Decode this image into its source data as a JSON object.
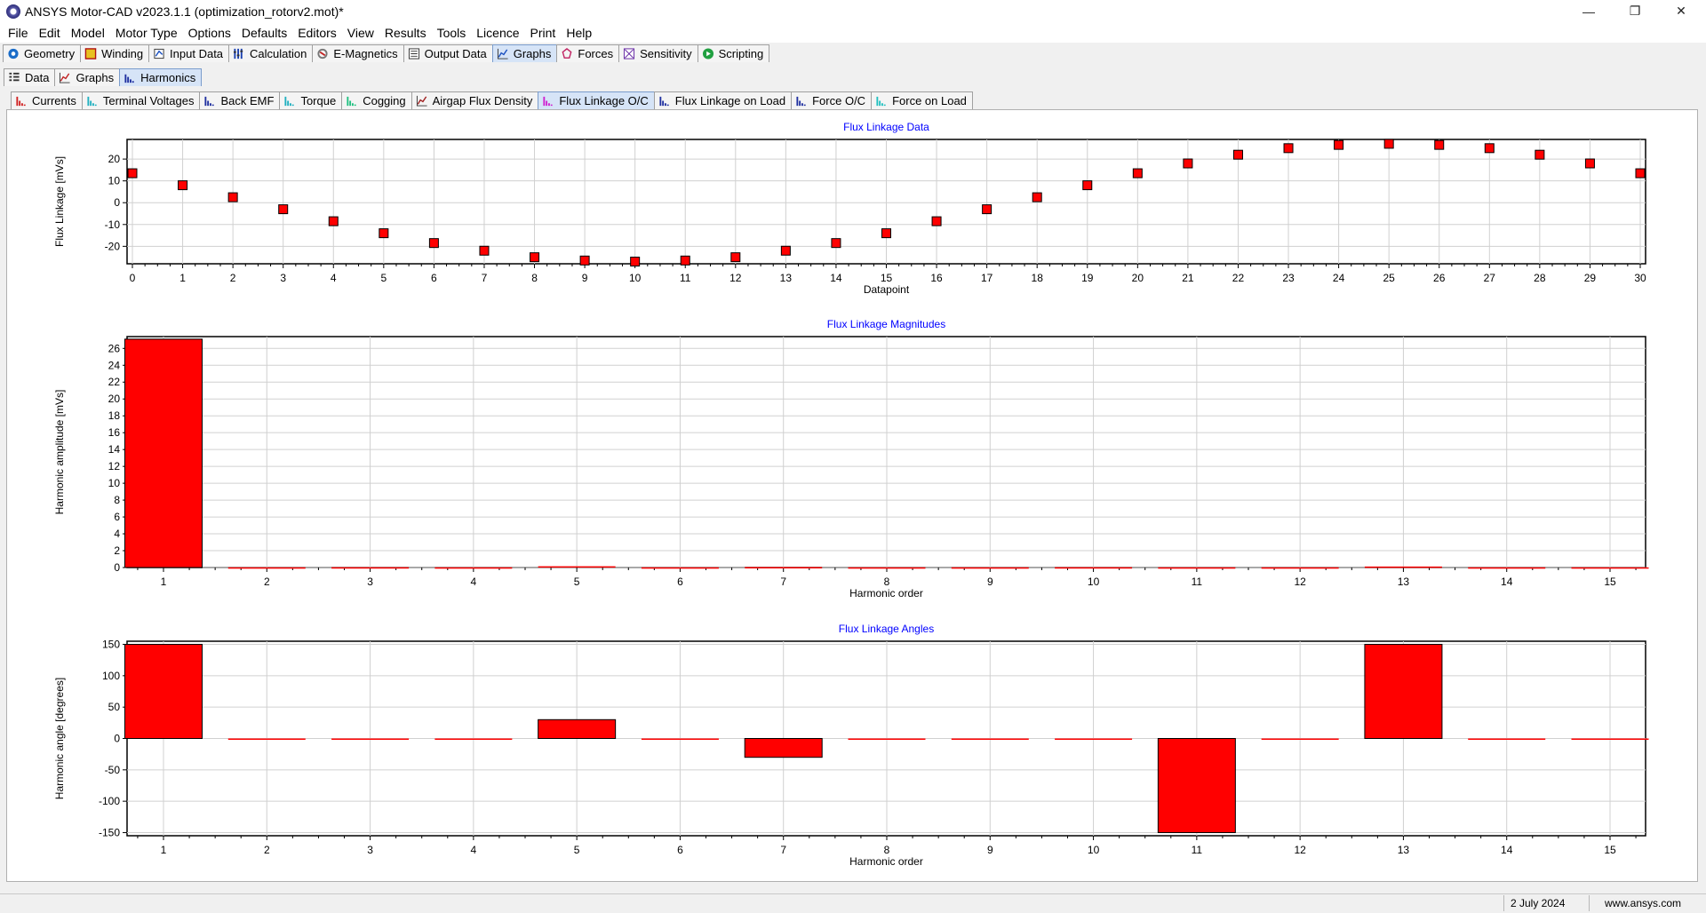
{
  "window": {
    "title": "ANSYS Motor-CAD v2023.1.1 (optimization_rotorv2.mot)*",
    "controls": [
      "minimize-icon",
      "restore-icon",
      "close-icon"
    ]
  },
  "menu": [
    "File",
    "Edit",
    "Model",
    "Motor Type",
    "Options",
    "Defaults",
    "Editors",
    "View",
    "Results",
    "Tools",
    "Licence",
    "Print",
    "Help"
  ],
  "main_tabs": [
    {
      "label": "Geometry",
      "icon": "geometry-icon",
      "active": false
    },
    {
      "label": "Winding",
      "icon": "winding-icon",
      "active": false
    },
    {
      "label": "Input Data",
      "icon": "input-data-icon",
      "active": false
    },
    {
      "label": "Calculation",
      "icon": "calculation-icon",
      "active": false
    },
    {
      "label": "E-Magnetics",
      "icon": "e-magnetics-icon",
      "active": false
    },
    {
      "label": "Output Data",
      "icon": "output-data-icon",
      "active": false
    },
    {
      "label": "Graphs",
      "icon": "graphs-icon",
      "active": true
    },
    {
      "label": "Forces",
      "icon": "forces-icon",
      "active": false
    },
    {
      "label": "Sensitivity",
      "icon": "sensitivity-icon",
      "active": false
    },
    {
      "label": "Scripting",
      "icon": "scripting-icon",
      "active": false
    }
  ],
  "sub_tabs": [
    {
      "label": "Data",
      "icon": "data-grid-icon",
      "active": false
    },
    {
      "label": "Graphs",
      "icon": "line-graph-icon",
      "active": false
    },
    {
      "label": "Harmonics",
      "icon": "harmonics-icon",
      "active": true
    }
  ],
  "harmonic_tabs": [
    {
      "label": "Currents",
      "color": "#d02020",
      "active": false
    },
    {
      "label": "Terminal Voltages",
      "color": "#20b0c0",
      "active": false
    },
    {
      "label": "Back EMF",
      "color": "#2030a0",
      "active": false
    },
    {
      "label": "Torque",
      "color": "#20b0c0",
      "active": false
    },
    {
      "label": "Cogging",
      "color": "#20c080",
      "active": false
    },
    {
      "label": "Airgap Flux Density",
      "color": "#a02020",
      "active": false
    },
    {
      "label": "Flux Linkage O/C",
      "color": "#d020d0",
      "active": true
    },
    {
      "label": "Flux Linkage on Load",
      "color": "#2030a0",
      "active": false
    },
    {
      "label": "Force O/C",
      "color": "#2030a0",
      "active": false
    },
    {
      "label": "Force on Load",
      "color": "#20c0c0",
      "active": false
    }
  ],
  "status": {
    "date": "2 July 2024",
    "website": "www.ansys.com"
  },
  "colors": {
    "series": "#ff0000",
    "title": "#0000ff",
    "grid": "#d0d0d0"
  },
  "chart_data": [
    {
      "type": "scatter",
      "title": "Flux Linkage Data",
      "xlabel": "Datapoint",
      "ylabel": "Flux Linkage [mVs]",
      "xlim": [
        0,
        30
      ],
      "ylim": [
        -28,
        29
      ],
      "yticks": [
        -20,
        -10,
        0,
        10,
        20
      ],
      "grid": true,
      "x": [
        0,
        1,
        2,
        3,
        4,
        5,
        6,
        7,
        8,
        9,
        10,
        11,
        12,
        13,
        14,
        15,
        16,
        17,
        18,
        19,
        20,
        21,
        22,
        23,
        24,
        25,
        26,
        27,
        28,
        29,
        30
      ],
      "values": [
        13.5,
        8,
        2.5,
        -3,
        -8.5,
        -14,
        -18.5,
        -22,
        -25,
        -26.5,
        -27,
        -26.5,
        -25,
        -22,
        -18.5,
        -14,
        -8.5,
        -3,
        2.5,
        8,
        13.5,
        18,
        22,
        25,
        26.5,
        27,
        26.5,
        25,
        22,
        18,
        13.5
      ]
    },
    {
      "type": "bar",
      "title": "Flux Linkage Magnitudes",
      "xlabel": "Harmonic order",
      "ylabel": "Harmonic amplitude [mVs]",
      "categories": [
        "1",
        "2",
        "3",
        "4",
        "5",
        "6",
        "7",
        "8",
        "9",
        "10",
        "11",
        "12",
        "13",
        "14",
        "15"
      ],
      "values": [
        27.1,
        0.02,
        0.03,
        0.02,
        0.15,
        0.02,
        0.05,
        0.02,
        0.02,
        0.03,
        0.02,
        0.02,
        0.12,
        0.02,
        0.02
      ],
      "ylim": [
        0,
        27.4
      ],
      "yticks": [
        0,
        2,
        4,
        6,
        8,
        10,
        12,
        14,
        16,
        18,
        20,
        22,
        24,
        26
      ],
      "grid": true
    },
    {
      "type": "bar",
      "title": "Flux Linkage Angles",
      "xlabel": "Harmonic order",
      "ylabel": "Harmonic angle [degrees]",
      "categories": [
        "1",
        "2",
        "3",
        "4",
        "5",
        "6",
        "7",
        "8",
        "9",
        "10",
        "11",
        "12",
        "13",
        "14",
        "15"
      ],
      "values": [
        150,
        0,
        0,
        0,
        30,
        0,
        -30,
        0,
        0,
        0,
        -150,
        0,
        150,
        0,
        0
      ],
      "ylim": [
        -155,
        155
      ],
      "yticks": [
        -150,
        -100,
        -50,
        0,
        50,
        100,
        150
      ],
      "grid": true
    }
  ]
}
